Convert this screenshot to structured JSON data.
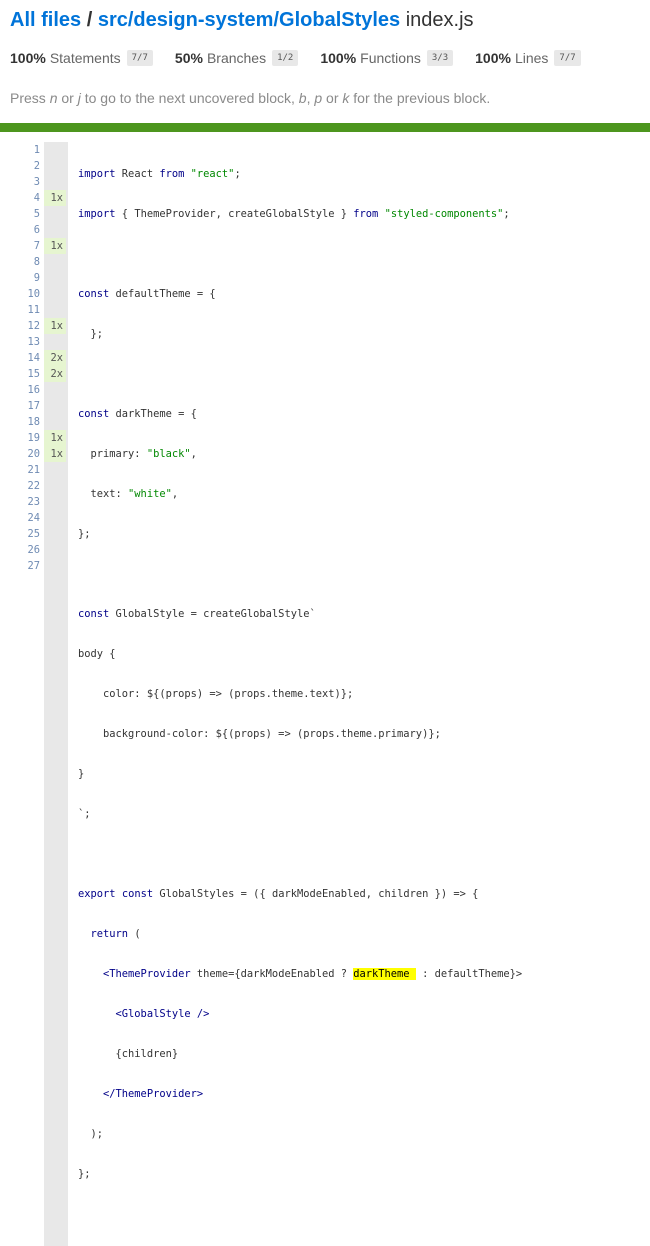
{
  "breadcrumb": {
    "all_files": "All files",
    "separator": "/",
    "folder": "src/design-system/GlobalStyles",
    "file": "index.js"
  },
  "summary": [
    {
      "pct": "100%",
      "label": "Statements",
      "fraction": "7/7"
    },
    {
      "pct": "50%",
      "label": "Branches",
      "fraction": "1/2"
    },
    {
      "pct": "100%",
      "label": "Functions",
      "fraction": "3/3"
    },
    {
      "pct": "100%",
      "label": "Lines",
      "fraction": "7/7"
    }
  ],
  "hint": {
    "p1": "Press ",
    "k1": "n",
    "p2": " or ",
    "k2": "j",
    "p3": " to go to the next uncovered block, ",
    "k3": "b",
    "p4": ", ",
    "k4": "p",
    "p5": " or ",
    "k5": "k",
    "p6": " for the previous block."
  },
  "colors": {
    "link": "#0074D9",
    "status_bar": "#4D961E",
    "covered": "#E6F5D0",
    "highlight": "#FFFF00"
  },
  "lines": [
    {
      "n": "1",
      "c": ""
    },
    {
      "n": "2",
      "c": ""
    },
    {
      "n": "3",
      "c": ""
    },
    {
      "n": "4",
      "c": "1x"
    },
    {
      "n": "5",
      "c": ""
    },
    {
      "n": "6",
      "c": ""
    },
    {
      "n": "7",
      "c": "1x"
    },
    {
      "n": "8",
      "c": ""
    },
    {
      "n": "9",
      "c": ""
    },
    {
      "n": "10",
      "c": ""
    },
    {
      "n": "11",
      "c": ""
    },
    {
      "n": "12",
      "c": "1x"
    },
    {
      "n": "13",
      "c": ""
    },
    {
      "n": "14",
      "c": "2x"
    },
    {
      "n": "15",
      "c": "2x"
    },
    {
      "n": "16",
      "c": ""
    },
    {
      "n": "17",
      "c": ""
    },
    {
      "n": "18",
      "c": ""
    },
    {
      "n": "19",
      "c": "1x"
    },
    {
      "n": "20",
      "c": "1x"
    },
    {
      "n": "21",
      "c": ""
    },
    {
      "n": "22",
      "c": ""
    },
    {
      "n": "23",
      "c": ""
    },
    {
      "n": "24",
      "c": ""
    },
    {
      "n": "25",
      "c": ""
    },
    {
      "n": "26",
      "c": ""
    },
    {
      "n": "27",
      "c": ""
    }
  ],
  "code": {
    "l1": {
      "a": "import",
      "b": " React ",
      "c": "from",
      "d": " ",
      "e": "\"react\"",
      "f": ";"
    },
    "l2": {
      "a": "import",
      "b": " { ThemeProvider, createGlobalStyle } ",
      "c": "from",
      "d": " ",
      "e": "\"styled-components\"",
      "f": ";"
    },
    "l4": {
      "a": "const",
      "b": " defaultTheme = {"
    },
    "l5": {
      "a": "  };"
    },
    "l7": {
      "a": "const",
      "b": " darkTheme = {"
    },
    "l8": {
      "a": "  primary: ",
      "b": "\"black\"",
      "c": ","
    },
    "l9": {
      "a": "  text: ",
      "b": "\"white\"",
      "c": ","
    },
    "l10": {
      "a": "};"
    },
    "l12": {
      "a": "const",
      "b": " GlobalStyle = createGlobalStyle`"
    },
    "l13": {
      "a": "body {"
    },
    "l14": {
      "a": "    color: ${(props) => (props.theme.text)};"
    },
    "l15": {
      "a": "    background-color: ${(props) => (props.theme.primary)};"
    },
    "l16": {
      "a": "}"
    },
    "l17": {
      "a": "`;"
    },
    "l19": {
      "a": "export",
      "b": " ",
      "c": "const",
      "d": " GlobalStyles = ({ darkModeEnabled, children }) => {"
    },
    "l20": {
      "a": "  ",
      "b": "return",
      "c": " ("
    },
    "l21": {
      "a": "    <ThemeProvider",
      "b": " theme={darkModeEnabled ? ",
      "c": "darkTheme ",
      "d": " : defaultTheme}>"
    },
    "l22": {
      "a": "      <GlobalStyle />"
    },
    "l23": {
      "a": "      {children}"
    },
    "l24": {
      "a": "    </ThemeProvider>"
    },
    "l25": {
      "a": "  );"
    },
    "l26": {
      "a": "};"
    }
  }
}
